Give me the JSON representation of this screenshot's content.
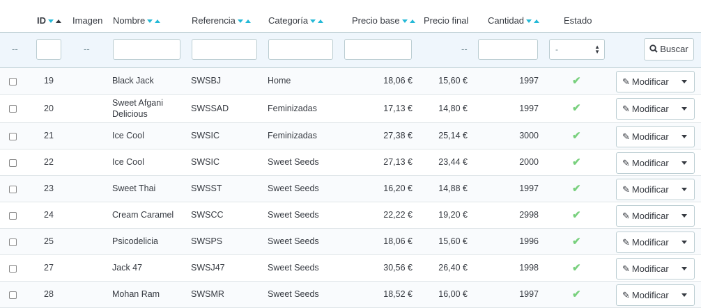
{
  "header": {
    "id": "ID",
    "image": "Imagen",
    "name": "Nombre",
    "reference": "Referencia",
    "category": "Categoría",
    "base_price": "Precio base",
    "final_price": "Precio final",
    "quantity": "Cantidad",
    "status": "Estado"
  },
  "filters": {
    "checkbox_dash": "--",
    "image_dash": "--",
    "final_price_dash": "--",
    "status_selected": "-",
    "search_label": "Buscar"
  },
  "rows": [
    {
      "id": "19",
      "name": "Black Jack",
      "name2": "",
      "ref": "SWSBJ",
      "category": "Home",
      "base": "18,06 €",
      "final": "15,60 €",
      "qty": "1997"
    },
    {
      "id": "20",
      "name": "Sweet Afgani",
      "name2": "Delicious",
      "ref": "SWSSAD",
      "category": "Feminizadas",
      "base": "17,13 €",
      "final": "14,80 €",
      "qty": "1997"
    },
    {
      "id": "21",
      "name": "Ice Cool",
      "name2": "",
      "ref": "SWSIC",
      "category": "Feminizadas",
      "base": "27,38 €",
      "final": "25,14 €",
      "qty": "3000"
    },
    {
      "id": "22",
      "name": "Ice Cool",
      "name2": "",
      "ref": "SWSIC",
      "category": "Sweet Seeds",
      "base": "27,13 €",
      "final": "23,44 €",
      "qty": "2000"
    },
    {
      "id": "23",
      "name": "Sweet Thai",
      "name2": "",
      "ref": "SWSST",
      "category": "Sweet Seeds",
      "base": "16,20 €",
      "final": "14,88 €",
      "qty": "1997"
    },
    {
      "id": "24",
      "name": "Cream Caramel",
      "name2": "",
      "ref": "SWSCC",
      "category": "Sweet Seeds",
      "base": "22,22 €",
      "final": "19,20 €",
      "qty": "2998"
    },
    {
      "id": "25",
      "name": "Psicodelicia",
      "name2": "",
      "ref": "SWSPS",
      "category": "Sweet Seeds",
      "base": "18,06 €",
      "final": "15,60 €",
      "qty": "1996"
    },
    {
      "id": "27",
      "name": "Jack 47",
      "name2": "",
      "ref": "SWSJ47",
      "category": "Sweet Seeds",
      "base": "30,56 €",
      "final": "26,40 €",
      "qty": "1998"
    },
    {
      "id": "28",
      "name": "Mohan Ram",
      "name2": "",
      "ref": "SWSMR",
      "category": "Sweet Seeds",
      "base": "18,52 €",
      "final": "16,00 €",
      "qty": "1997"
    }
  ],
  "row_action_label": "Modificar",
  "colors": {
    "accent": "#25b9d7",
    "status_ok": "#78d07d",
    "filter_bg": "#eff6fc"
  },
  "icons": {
    "sort": "sort-arrows-icon",
    "search": "search-icon",
    "status": "check-icon",
    "edit": "pencil-icon",
    "dropdown": "caret-down-icon"
  }
}
